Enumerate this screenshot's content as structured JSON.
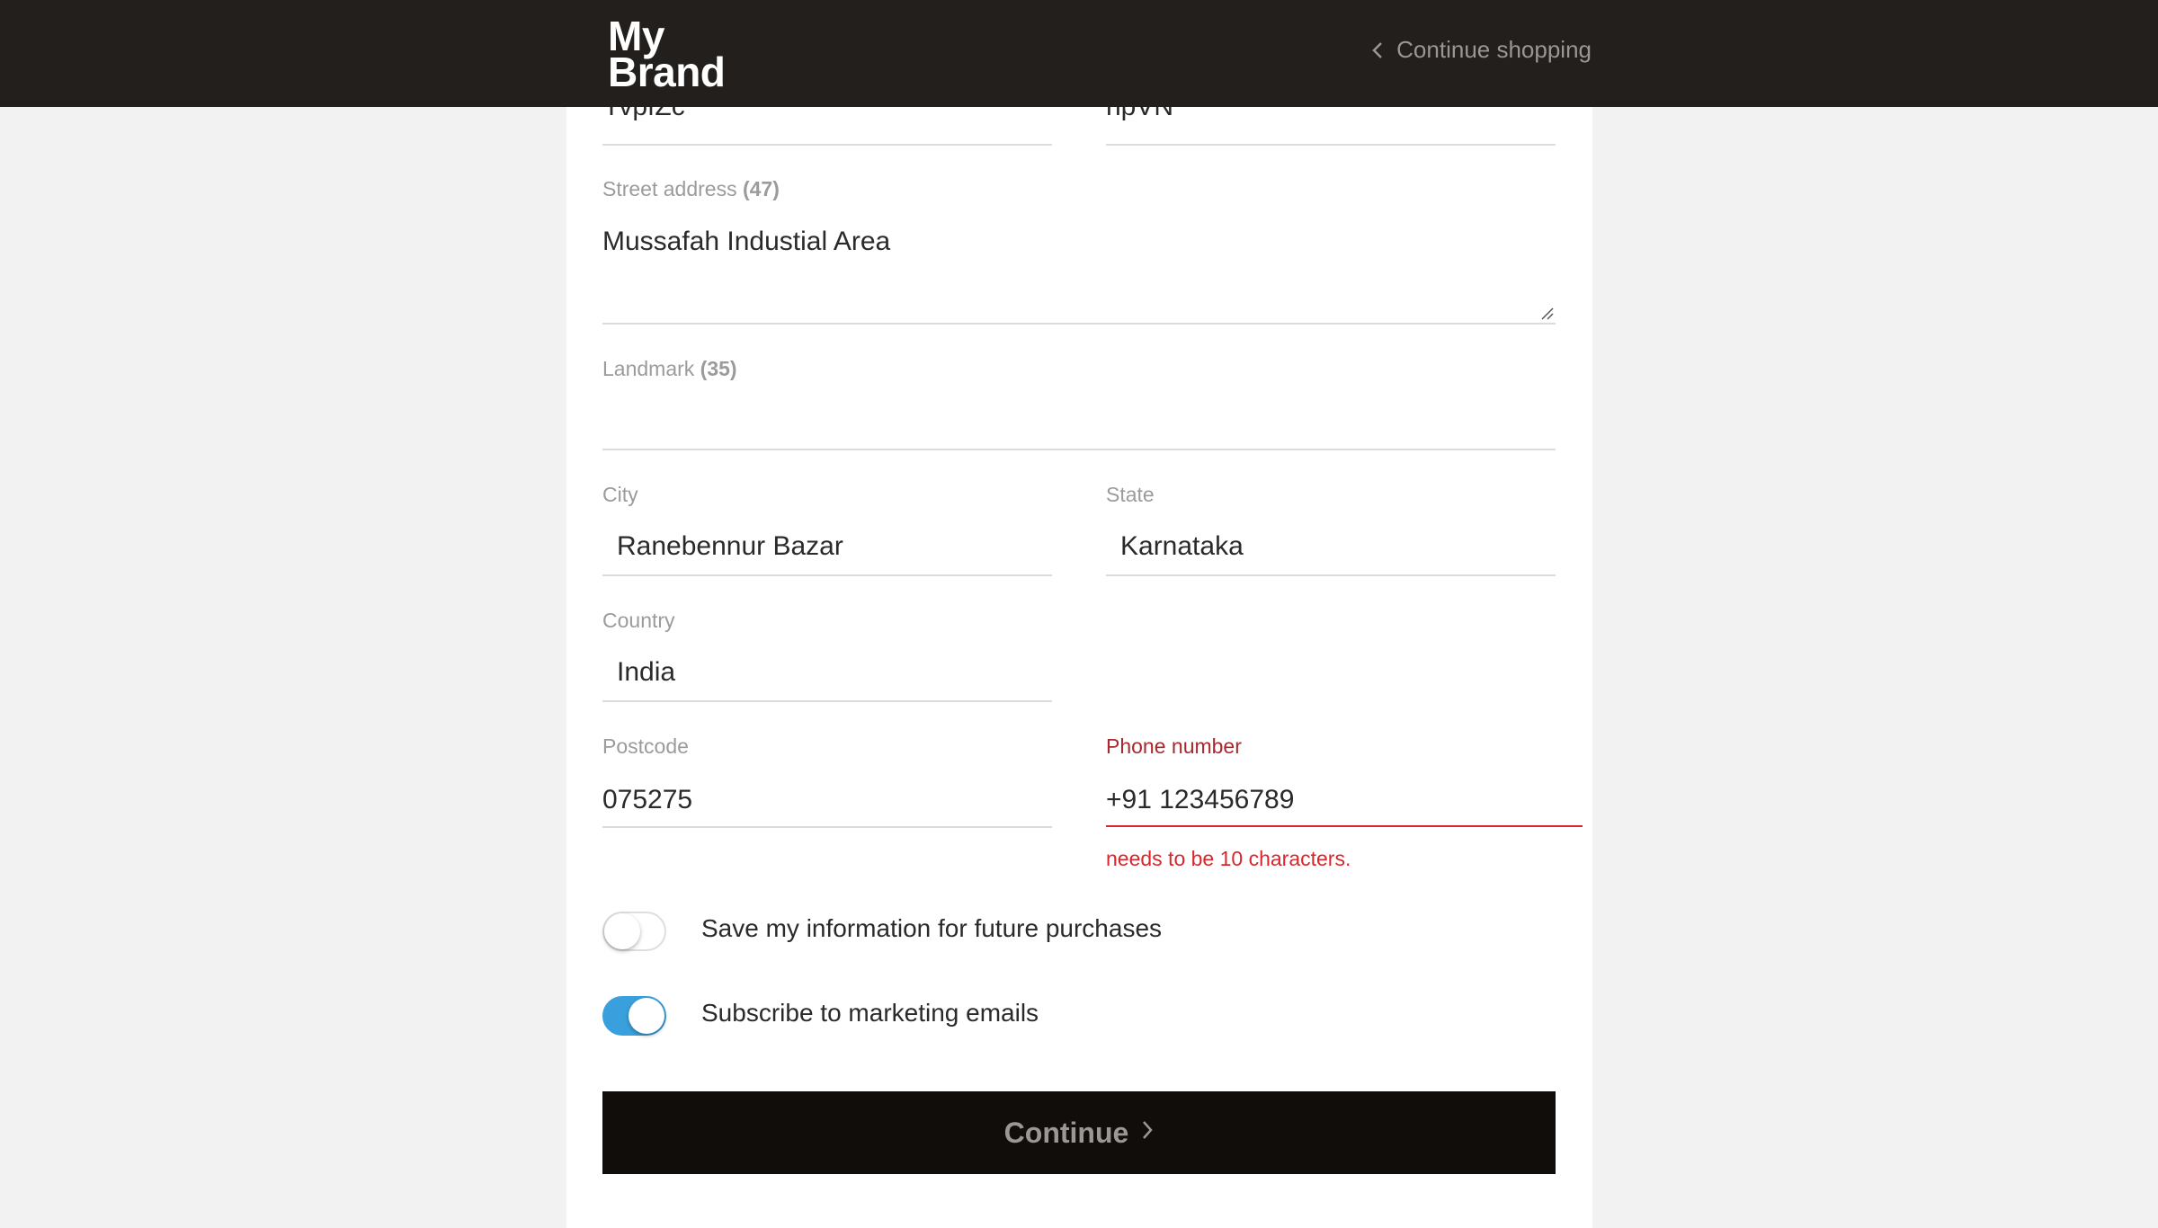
{
  "header": {
    "logo_line1": "My",
    "logo_line2": "Brand",
    "continue_shopping": "Continue shopping"
  },
  "form": {
    "first_name_value": "YvpfZc",
    "last_name_value": "npVN",
    "street": {
      "label": "Street address",
      "count": "(47)",
      "value": "Mussafah Industial Area"
    },
    "landmark": {
      "label": "Landmark",
      "count": "(35)",
      "value": ""
    },
    "city": {
      "label": "City",
      "value": "Ranebennur Bazar"
    },
    "state": {
      "label": "State",
      "value": "Karnataka"
    },
    "country": {
      "label": "Country",
      "value": "India"
    },
    "postcode": {
      "label": "Postcode",
      "value": "075275"
    },
    "phone": {
      "label": "Phone number",
      "value": "+91 123456789",
      "error": "needs to be 10 characters."
    },
    "save_info": {
      "label": "Save my information for future purchases",
      "checked": false
    },
    "subscribe": {
      "label": "Subscribe to marketing emails",
      "checked": true
    },
    "continue_label": "Continue"
  },
  "colors": {
    "header_bg": "#231f1c",
    "toggle_on": "#3aa0dd",
    "error": "#d9262c",
    "button_bg": "#110d0a"
  },
  "icons": {
    "back": "chevron-left-icon",
    "forward": "chevron-right-icon",
    "resize": "resize-grip-icon"
  }
}
